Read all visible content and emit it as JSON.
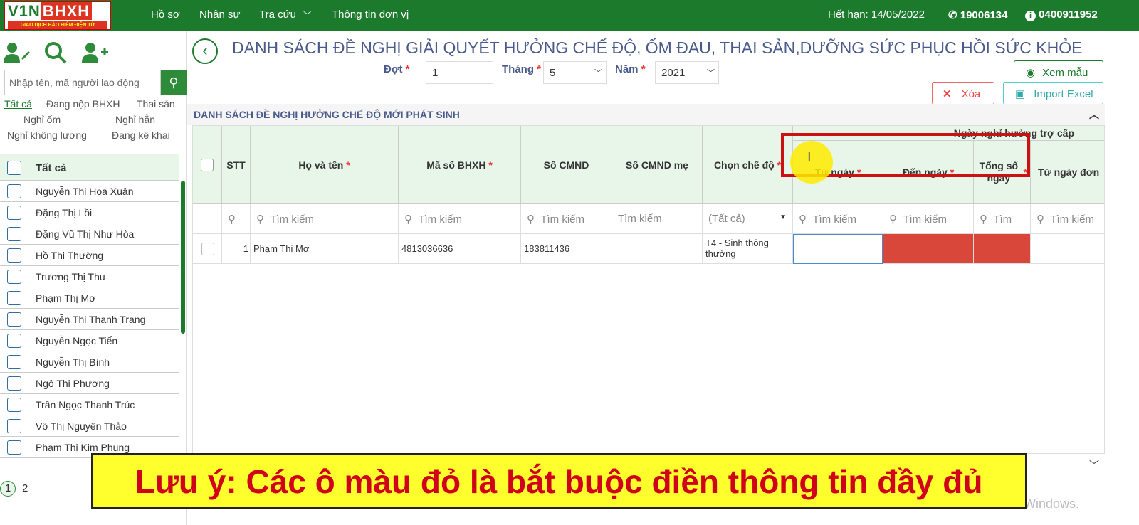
{
  "brand": {
    "logo_main": "V1N",
    "logo_accent": "BHXH",
    "logo_sub": "GIAO DỊCH BẢO HIỂM ĐIỆN TỬ"
  },
  "nav": {
    "items": [
      "Hồ sơ",
      "Nhân sự",
      "Tra cứu",
      "Thông tin đơn vị"
    ]
  },
  "top_right": {
    "expiry": "Hết hạn: 14/05/2022",
    "phone": "19006134",
    "account": "0400911952"
  },
  "sidebar": {
    "search_placeholder": "Nhập tên, mã người lao động",
    "filters": [
      "Tất cả",
      "Đang nộp BHXH",
      "Thai sản",
      "Nghỉ ốm",
      "Nghỉ hẳn",
      "Nghỉ không lương",
      "Đang kê khai"
    ],
    "all_label": "Tất cả",
    "people": [
      "Nguyễn Thị Hoa Xuân",
      "Đặng Thị Lồi",
      "Đặng Vũ Thị Như Hòa",
      "Hồ Thị Thường",
      "Trương Thị Thu",
      "Phạm Thị Mơ",
      "Nguyễn Thị Thanh Trang",
      "Nguyễn Ngọc Tiến",
      "Nguyễn Thị Bình",
      "Ngô Thị Phương",
      "Trần Ngọc Thanh Trúc",
      "Võ Thị Nguyên Thảo",
      "Phạm Thị Kim Phụng"
    ],
    "pages": [
      "1",
      "2"
    ]
  },
  "main": {
    "title": "DANH SÁCH ĐỀ NGHỊ GIẢI QUYẾT HƯỞNG CHẾ ĐỘ, ỐM ĐAU, THAI SẢN,DƯỠNG SỨC PHỤC HỒI SỨC KHỎE",
    "dot_label": "Đợt",
    "dot_value": "1",
    "thang_label": "Tháng",
    "thang_value": "5",
    "nam_label": "Năm",
    "nam_value": "2021",
    "btn_view": "Xem mẫu",
    "btn_delete": "Xóa",
    "btn_import": "Import Excel",
    "section_title": "DANH SÁCH ĐỀ NGHỊ HƯỞNG CHẾ ĐỘ MỚI PHÁT SINH"
  },
  "table": {
    "columns": {
      "stt": "STT",
      "name": "Họ và tên",
      "bhxh": "Mã số BHXH",
      "cmnd": "Số CMND",
      "cmnd_me": "Số CMND mẹ",
      "che_do": "Chọn chế độ",
      "group": "Ngày nghỉ hưởng trợ cấp",
      "tu_ngay": "Từ ngày",
      "den_ngay": "Đến ngày",
      "tong_so": "Tổng số ngày",
      "tu_ngay_don": "Từ ngày đơn"
    },
    "search_placeholder": "Tìm kiếm",
    "search_short": "Tìm",
    "che_do_filter": "(Tất cả)",
    "rows": [
      {
        "stt": "1",
        "name": "Phạm Thị Mơ",
        "bhxh": "4813036636",
        "cmnd": "183811436",
        "cmnd_me": "",
        "che_do": "T4 - Sinh thông thường"
      }
    ]
  },
  "notice": "Lưu ý: Các ô màu đỏ là bắt buộc điền thông tin đầy đủ",
  "watermark": "Windows."
}
